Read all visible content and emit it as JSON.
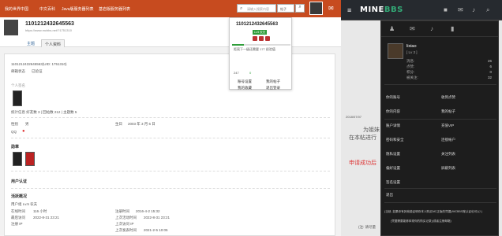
{
  "nav": {
    "items": [
      "我的世界中国",
      "中文百科",
      "Java版服务器列表",
      "基岩版服务器列表"
    ],
    "search_placeholder": "请输入搜索内容",
    "search_select": "帖子",
    "search_button": "⌕"
  },
  "profile": {
    "name": "1101212432645563",
    "url": "https://www.mcbbs.net/?1751310",
    "tabs": [
      "主题",
      "个人资料"
    ]
  },
  "content": {
    "name_line": "1101212432645563(UID: 1751310)",
    "email_label": "邮箱状态",
    "email_value": "已验证",
    "signature_label": "个人签名",
    "stats": "统计信息 好友数 3 | 回帖数 212 | 主题数 5",
    "gender_label": "性别",
    "gender_value": "男",
    "birthday_label": "生日",
    "birthday_value": "2003 年 3 月 6 日",
    "qq_label": "QQ",
    "medals_title": "勋章",
    "user_auth_title": "用户认证",
    "activity_title": "活跃概况",
    "usergroup": "用户组 Lv.5 农夫",
    "online_label": "在线时间",
    "online_value": "116 小时",
    "register_label": "注册时间",
    "register_value": "2016-4-2 15:32",
    "lastvisit_label": "最后访问",
    "lastvisit_value": "2022-8-31 23:21",
    "lastactive_label": "上次活动时间",
    "lastactive_value": "2022-8-31 23:21",
    "reg_ip_label": "注册 IP",
    "last_ip_label": "上次访问 IP",
    "last_post_label": "上次发表时间",
    "last_post_value": "2021-2-5 10:05"
  },
  "popup": {
    "username": "1101212432645563",
    "level": "Lv.5 农夫",
    "progress_text": "距离下一级还需要 177 经验值",
    "progress": 0.2,
    "stat1": "247",
    "stat2": "0",
    "stat3": "0",
    "btn_settings": "账号设置",
    "btn_posts": "我的帖子",
    "btn_favs": "我的收藏",
    "btn_logout": "退出登录"
  },
  "right": {
    "logo_a": "MINE",
    "logo_b": "BBS",
    "behind_date": "2018/07/07",
    "behind_text1": "为姐妹",
    "behind_text2": "在本帖进行",
    "behind_text3": "申请成功后",
    "behind_bottom1": "(注: 请尽量",
    "behind_bottom2": "(当然, 如果你有其他能证明你本人购买MC正版的凭据)/MCBBS账认证也可以! )",
    "behind_bottom3": "(凭据需要能够体现你的购买记录)(或者注册邮箱)",
    "user": "lixiao",
    "user_level": "[ Lv 3 ]",
    "stats": [
      {
        "label": "消息:",
        "value": "26"
      },
      {
        "label": "点赞:",
        "value": "6"
      },
      {
        "label": "积分:",
        "value": "0"
      },
      {
        "label": "被关注:",
        "value": "32"
      }
    ],
    "menu_left": [
      "你的账号",
      "你的内容",
      "你的回复",
      "账户详情",
      "密码和安全",
      "隐私设置",
      "偏好设置",
      "签名设置",
      "退出"
    ],
    "menu_right": [
      "收到点赞",
      "我的帖子",
      "充值VIP",
      "连接帐户",
      "关注列表",
      "屏蔽列表"
    ]
  }
}
